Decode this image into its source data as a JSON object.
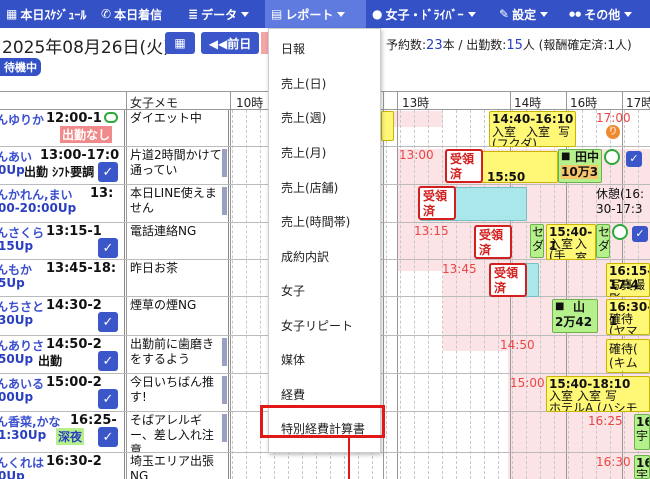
{
  "navbar": {
    "items": [
      {
        "icon": "calendar-icon",
        "glyph": "▦",
        "label": "本日ｽｹｼﾞｭｰﾙ"
      },
      {
        "icon": "phone-icon",
        "glyph": "✆",
        "label": "本日着信"
      },
      {
        "icon": "database-icon",
        "glyph": "≣",
        "label": "データ"
      },
      {
        "icon": "chart-icon",
        "glyph": "▤",
        "label": "レポート"
      },
      {
        "icon": "user-icon",
        "glyph": "●",
        "label": "女子・ﾄﾞﾗｲﾊﾞｰ"
      },
      {
        "icon": "wrench-icon",
        "glyph": "✎",
        "label": "設定"
      },
      {
        "icon": "more-icon",
        "glyph": "●●",
        "label": "その他"
      }
    ]
  },
  "datebar": {
    "date": "2025年08月26日(火)",
    "prev_label": "◀◀前日",
    "summary_prefix": "予約数:",
    "reservations": "23",
    "summary_mid": "本 / 出勤数:",
    "attendance": "15",
    "summary_suffix": "人 (報酬確定済:1人)",
    "standby": "待機中"
  },
  "grid": {
    "memo_header": "女子メモ",
    "hours": [
      "10時",
      "13時",
      "14時",
      "16時",
      "17時"
    ],
    "rows": [
      {
        "name": "んゆりか",
        "time": "12:00-1",
        "line2a": "",
        "line2b": "出勤なし",
        "memo": "ダイエット中"
      },
      {
        "name": "んあい",
        "time": "13:00-17:0",
        "line2a": "0Up",
        "line2b": "出勤 ｼﾌﾄ要調",
        "memo": "片道2時間かけて通ってい"
      },
      {
        "name": "んかれん,まい",
        "time": "13:",
        "line2a": "00-20:00Up",
        "line2b": "",
        "memo": "本日LINE使えません"
      },
      {
        "name": "んさくら",
        "time": "13:15-1",
        "line2a": "15Up",
        "line2b": "",
        "memo": "電話連絡NG"
      },
      {
        "name": "んもか",
        "time": "13:45-18:",
        "line2a": "5Up",
        "line2b": "",
        "memo": "昨日お茶"
      },
      {
        "name": "んちさと",
        "time": "14:30-2",
        "line2a": "30Up",
        "line2b": "",
        "memo": "煙草の煙NG"
      },
      {
        "name": "んありさ",
        "time": "14:50-2",
        "line2a": "50Up",
        "line2b": "出勤",
        "memo": "出勤前に歯磨きをするよう"
      },
      {
        "name": "んあいる",
        "time": "15:00-2",
        "line2a": "00Up",
        "line2b": "",
        "memo": "今日いちばん推す!"
      },
      {
        "name": "ん香菜,かな",
        "time": "16:25-",
        "line2a": "1:30Up",
        "line2b": "深夜",
        "memo": "そばアレルギー、差し入れ注意"
      },
      {
        "name": "んくれは",
        "time": "16:30-2",
        "line2a": "0Up",
        "line2b": "",
        "memo": "埼玉エリア出張NG"
      }
    ],
    "cells": {
      "r0_red": "17:00",
      "r0_block": [
        "14:40-16:10",
        "入室",
        "入室",
        "写",
        "(フクダ)"
      ],
      "r1_red": "13:00",
      "stamp": [
        "受領",
        "済"
      ],
      "r1_block": "15:50 15:50",
      "r1_green": [
        "田中",
        "10万3"
      ],
      "r2_rest": [
        "休憩(16:",
        "30-17:3"
      ],
      "r3_red": "13:15",
      "r3_block": [
        "15:40-1",
        "入室",
        "入室",
        "(手"
      ],
      "r3_sep": [
        "セ",
        "ダ"
      ],
      "r4_red": "13:45",
      "r4_block": [
        "16:15-17:4",
        "写真撮影"
      ],
      "r5_block": [
        "山",
        "2万42"
      ],
      "r5_block2": [
        "16:30-1",
        "確待",
        "(ヤマ"
      ],
      "r6_red": "14:50",
      "r6_block": [
        "確待(",
        "(キムラ)"
      ],
      "r7_red": "15:00",
      "r7_block": [
        "15:40-18:10",
        "入室",
        "入室",
        "写",
        "ホテルA",
        "(ハシモ"
      ],
      "r8_red": "16:25",
      "r8_green": [
        "16:",
        "宇"
      ],
      "r9_red": "16:30",
      "r9_green": [
        "16:",
        "宇"
      ]
    }
  },
  "report_menu": {
    "items": [
      "日報",
      "売上(日)",
      "売上(週)",
      "売上(月)",
      "売上(店舗)",
      "売上(時間帯)",
      "成約内訳",
      "女子",
      "女子リピート",
      "媒体",
      "経費",
      "特別経費計算書"
    ]
  }
}
